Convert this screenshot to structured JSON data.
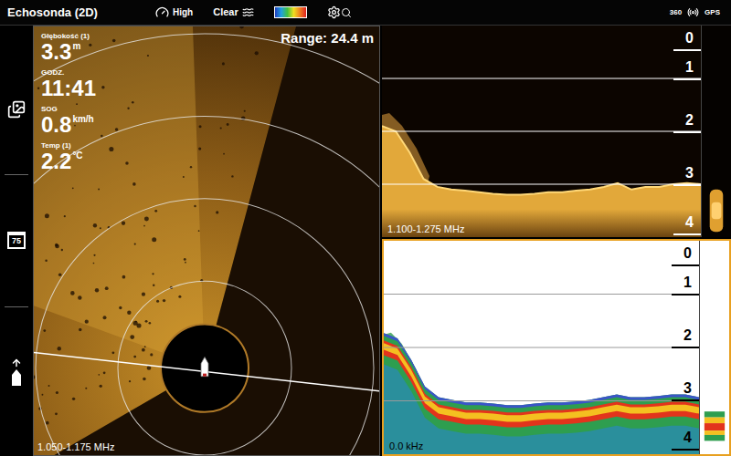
{
  "window": {
    "title": "Echosonda (2D)"
  },
  "top_bar": {
    "sensitivity": "High",
    "mode": "Clear",
    "status": [
      "360",
      "GPS"
    ]
  },
  "sidebar": {
    "badge": "75"
  },
  "imaging_panel": {
    "range": "Range: 24.4 m",
    "frequency": "1.050-1.175 MHz",
    "readouts": [
      {
        "label": "Głębokość (1)",
        "value": "3.3",
        "unit": "m"
      },
      {
        "label": "GODZ.",
        "value": "11:41"
      },
      {
        "label": "SOG",
        "value": "0.8",
        "unit": "km/h"
      },
      {
        "label": "Temp (1)",
        "value": "2.2",
        "unit": "°C"
      }
    ]
  },
  "sonar_panels": [
    {
      "kind": "amber",
      "selected": false,
      "frequency": "1.100-1.275 MHz",
      "scale": [
        "0",
        "1",
        "2",
        "3",
        "4"
      ],
      "bottom_depth_m": [
        1.9,
        2.0,
        2.4,
        2.9,
        3.05,
        3.1,
        3.12,
        3.15,
        3.18,
        3.2,
        3.2,
        3.18,
        3.15,
        3.15,
        3.12,
        3.1,
        3.05,
        2.98,
        3.1,
        3.05,
        3.05,
        3.0,
        2.98,
        3.0
      ],
      "flasher": {
        "from": 3.1,
        "to": 3.9
      }
    },
    {
      "kind": "color",
      "selected": true,
      "frequency": "0.0 kHz",
      "scale": [
        "0",
        "1",
        "2",
        "3",
        "4"
      ],
      "bottom_depth_m": [
        1.8,
        1.9,
        2.3,
        2.8,
        3.0,
        3.05,
        3.1,
        3.1,
        3.12,
        3.15,
        3.15,
        3.12,
        3.1,
        3.1,
        3.08,
        3.05,
        3.0,
        2.95,
        3.0,
        3.0,
        2.98,
        2.95,
        2.95,
        3.0
      ],
      "flasher": {
        "from": 3.2,
        "to": 3.75
      }
    }
  ]
}
